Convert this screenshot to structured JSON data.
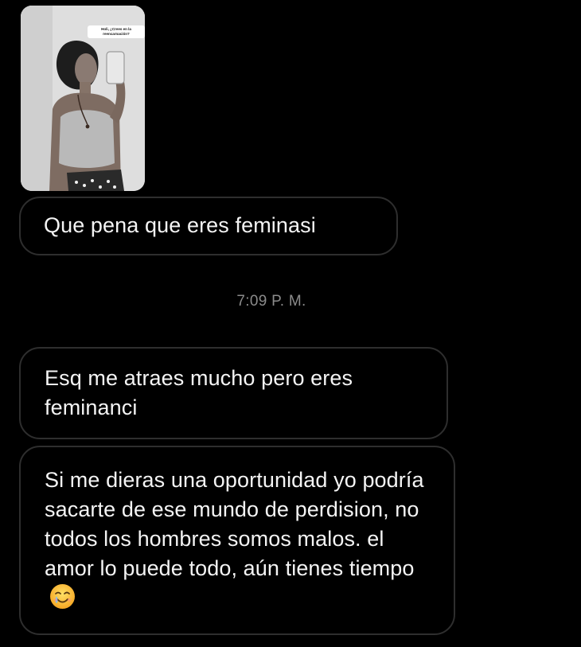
{
  "story_reply": {
    "caption": "Holi, ¿Crees en la reencarnación?"
  },
  "messages": [
    {
      "text": "Que pena que eres feminasi"
    },
    {
      "text": "Esq me atraes mucho pero eres feminanci"
    },
    {
      "text": "Si me dieras una oportunidad yo podría sacarte de ese mundo de perdision, no todos los hombres somos malos. el amor lo puede todo, aún tienes tiempo",
      "emoji": "smiling-face-with-tear-emoji"
    }
  ],
  "timestamp": "7:09 P. M.",
  "colors": {
    "background": "#000000",
    "bubble_border": "#2e2e2e",
    "text": "#f4f4f4",
    "timestamp": "#8b8b8b"
  }
}
